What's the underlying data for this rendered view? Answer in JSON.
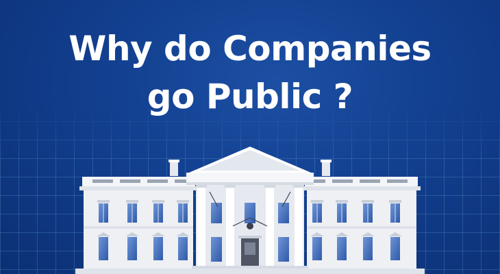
{
  "headline": {
    "line1": "Why do Companies",
    "line2": "go Public ?"
  },
  "colors": {
    "background": "#123f8f",
    "grid": "#78c8e6",
    "text": "#ffffff",
    "building": "#eef0f4",
    "windows": "#3e6dbf"
  }
}
